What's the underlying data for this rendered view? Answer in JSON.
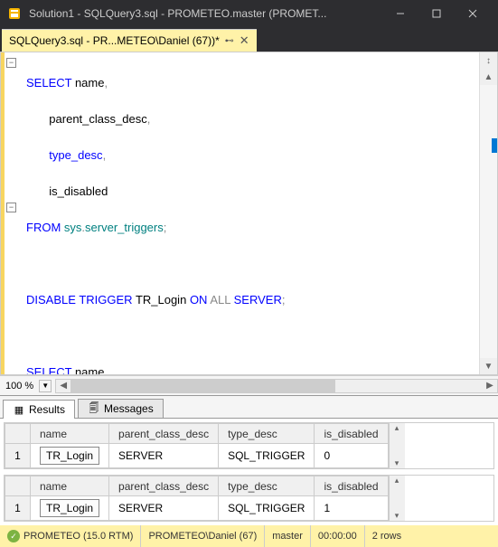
{
  "window": {
    "title": "Solution1 - SQLQuery3.sql - PROMETEO.master (PROMET..."
  },
  "tab": {
    "label": "SQLQuery3.sql - PR...METEO\\Daniel (67))*"
  },
  "editor": {
    "zoom": "100 %",
    "lines": [
      {
        "t": "SELECT",
        "c": "kw-blue"
      },
      {
        "t": " name",
        "c": "kw-black"
      },
      {
        "t": ",",
        "c": "kw-gray"
      },
      {
        "t": "parent_class_desc",
        "c": "kw-black"
      },
      {
        "t": ",",
        "c": "kw-gray"
      },
      {
        "t": "type_desc",
        "c": "kw-blue"
      },
      {
        "t": ",",
        "c": "kw-gray"
      },
      {
        "t": "is_disabled",
        "c": "kw-black"
      },
      {
        "t": "FROM",
        "c": "kw-blue"
      },
      {
        "t": " sys",
        "c": "kw-green"
      },
      {
        "t": ".",
        "c": "kw-gray"
      },
      {
        "t": "server_triggers",
        "c": "kw-green"
      },
      {
        "t": ";",
        "c": "kw-gray"
      },
      {
        "t": "DISABLE",
        "c": "kw-blue"
      },
      {
        "t": " TRIGGER",
        "c": "kw-blue"
      },
      {
        "t": " TR_Login ",
        "c": "kw-black"
      },
      {
        "t": "ON",
        "c": "kw-blue"
      },
      {
        "t": " ALL",
        "c": "kw-gray"
      },
      {
        "t": " SERVER",
        "c": "kw-blue"
      },
      {
        "t": ";",
        "c": "kw-gray"
      }
    ]
  },
  "results": {
    "tab_results": "Results",
    "tab_messages": "Messages",
    "headers": [
      "name",
      "parent_class_desc",
      "type_desc",
      "is_disabled"
    ],
    "grid1": {
      "rownum": "1",
      "cells": [
        "TR_Login",
        "SERVER",
        "SQL_TRIGGER",
        "0"
      ]
    },
    "grid2": {
      "rownum": "1",
      "cells": [
        "TR_Login",
        "SERVER",
        "SQL_TRIGGER",
        "1"
      ]
    }
  },
  "status": {
    "server": "PROMETEO (15.0 RTM)",
    "user": "PROMETEO\\Daniel (67)",
    "db": "master",
    "time": "00:00:00",
    "rows": "2 rows"
  }
}
